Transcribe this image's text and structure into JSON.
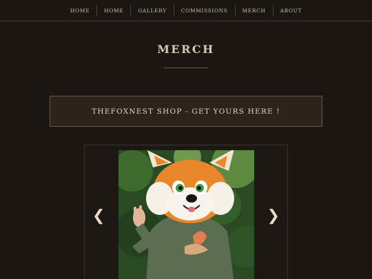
{
  "nav": {
    "items": [
      {
        "label": "HOME"
      },
      {
        "label": "HOME"
      },
      {
        "label": "GALLERY"
      },
      {
        "label": "COMMISSIONS"
      },
      {
        "label": "MERCH"
      },
      {
        "label": "ABOUT"
      }
    ]
  },
  "page": {
    "title": "MERCH"
  },
  "shop_banner": {
    "label": "THEFOXNEST SHOP - GET YOURS HERE !"
  },
  "carousel": {
    "prev_label": "❮",
    "next_label": "❯",
    "image_icon": "fox-fursuit-photo"
  },
  "colors": {
    "background": "#1c1612",
    "banner_bg": "#2c231b",
    "border": "#6a5846",
    "text": "#d8c8b0"
  }
}
